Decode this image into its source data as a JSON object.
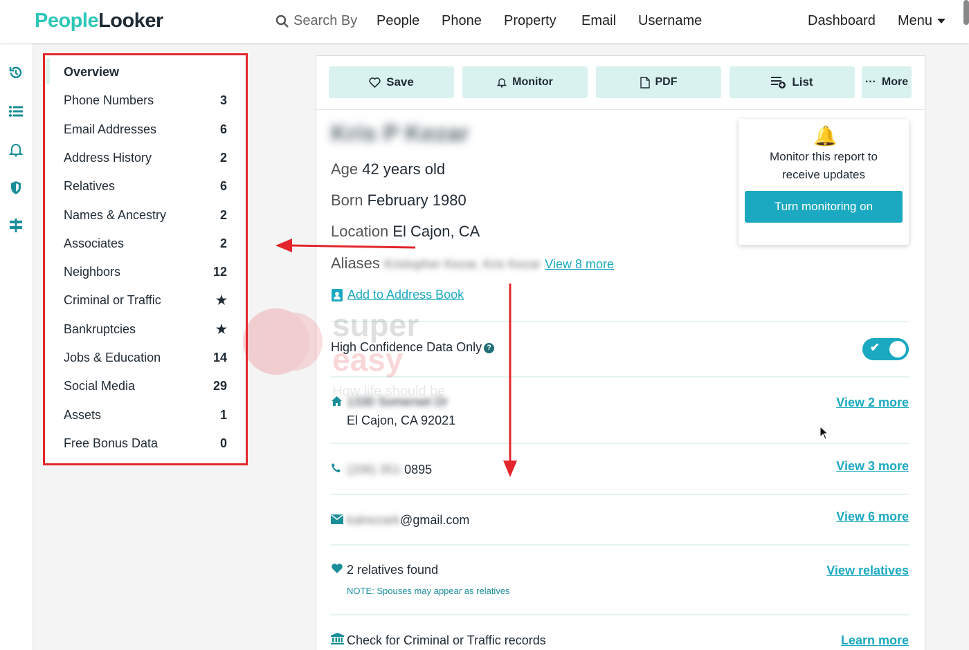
{
  "brand": {
    "part1": "People",
    "part2": "Looker"
  },
  "nav": {
    "search_by": "Search By",
    "items": [
      "People",
      "Phone",
      "Property",
      "Email",
      "Username"
    ],
    "dashboard": "Dashboard",
    "menu": "Menu"
  },
  "rail_icons": [
    "history-icon",
    "list-icon",
    "bell-icon",
    "shield-icon",
    "signpost-icon"
  ],
  "sidebar": {
    "items": [
      {
        "label": "Overview",
        "count": ""
      },
      {
        "label": "Phone Numbers",
        "count": "3"
      },
      {
        "label": "Email Addresses",
        "count": "6"
      },
      {
        "label": "Address History",
        "count": "2"
      },
      {
        "label": "Relatives",
        "count": "6"
      },
      {
        "label": "Names & Ancestry",
        "count": "2"
      },
      {
        "label": "Associates",
        "count": "2"
      },
      {
        "label": "Neighbors",
        "count": "12"
      },
      {
        "label": "Criminal or Traffic",
        "count": "★"
      },
      {
        "label": "Bankruptcies",
        "count": "★"
      },
      {
        "label": "Jobs & Education",
        "count": "14"
      },
      {
        "label": "Social Media",
        "count": "29"
      },
      {
        "label": "Assets",
        "count": "1"
      },
      {
        "label": "Free Bonus Data",
        "count": "0"
      }
    ]
  },
  "toolbar": {
    "save": "Save",
    "monitor": "Monitor",
    "pdf": "PDF",
    "list": "List",
    "more": "More"
  },
  "profile": {
    "name": "Kris P Kezar",
    "age_label": "Age",
    "age_value": "42 years old",
    "born_label": "Born",
    "born_value": "February 1980",
    "location_label": "Location",
    "location_value": "El Cajon, CA",
    "aliases_label": "Aliases",
    "aliases_value": "Kristopher Kezar, Kris Kezar",
    "aliases_link": "View 8 more",
    "address_book": "Add to Address Book"
  },
  "monitor_box": {
    "text": "Monitor this report to receive updates",
    "button": "Turn monitoring on"
  },
  "confidence": {
    "label": "High Confidence Data Only",
    "enabled": true
  },
  "details": {
    "address_line1": "1330 Somerset Dr",
    "address_line2": "El Cajon, CA 92021",
    "address_link": "View 2 more",
    "phone_hidden": "(206) 351-",
    "phone_visible": "0895",
    "phone_link": "View 3 more",
    "email_hidden": "kalnezark",
    "email_visible": "@gmail.com",
    "email_link": "View 6 more",
    "relatives": "2 relatives found",
    "relatives_note": "NOTE: Spouses may appear as relatives",
    "relatives_link": "View relatives",
    "criminal": "Check for Criminal or Traffic records",
    "criminal_link": "Learn more"
  },
  "watermark": {
    "line1": "super",
    "line2": "easy",
    "tagline": "How life should be"
  },
  "colors": {
    "brand_teal": "#2bc7b7",
    "link": "#1aa9c1",
    "annotation_red": "#e3262c",
    "button_bg": "#d9f2f0"
  }
}
